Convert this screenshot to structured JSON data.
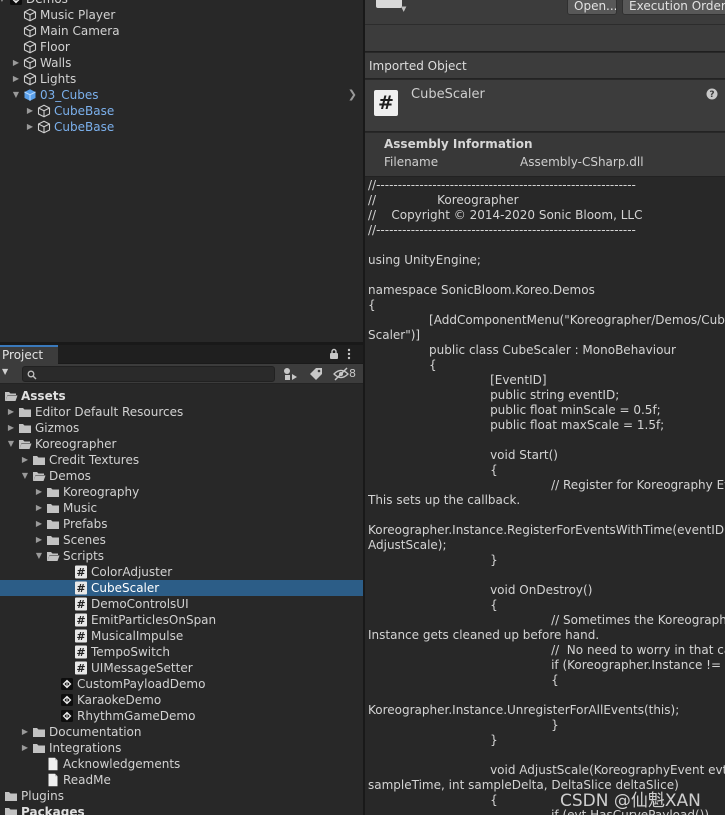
{
  "hierarchy": {
    "items": [
      {
        "label": "Demos",
        "depth": 1,
        "expand": "open",
        "icon": "unity-scene-icon",
        "blue": false
      },
      {
        "label": "Music Player",
        "depth": 2,
        "expand": "none",
        "icon": "gameobject-icon",
        "blue": false
      },
      {
        "label": "Main Camera",
        "depth": 2,
        "expand": "none",
        "icon": "gameobject-icon",
        "blue": false
      },
      {
        "label": "Floor",
        "depth": 2,
        "expand": "none",
        "icon": "gameobject-icon",
        "blue": false
      },
      {
        "label": "Walls",
        "depth": 2,
        "expand": "closed",
        "icon": "gameobject-icon",
        "blue": false
      },
      {
        "label": "Lights",
        "depth": 2,
        "expand": "closed",
        "icon": "gameobject-icon",
        "blue": false
      },
      {
        "label": "03_Cubes",
        "depth": 2,
        "expand": "open",
        "icon": "prefab-icon",
        "blue": true,
        "chevron": true
      },
      {
        "label": "CubeBase",
        "depth": 3,
        "expand": "closed",
        "icon": "prefab-outline-icon",
        "blue": true
      },
      {
        "label": "CubeBase",
        "depth": 3,
        "expand": "closed",
        "icon": "prefab-outline-icon",
        "blue": true
      }
    ]
  },
  "project": {
    "tab_label": "Project",
    "search_placeholder": "",
    "hidden_count": "8",
    "tree": [
      {
        "label": "Assets",
        "depth": 0,
        "expand": "open",
        "icon": "folder-open-icon",
        "bold": true
      },
      {
        "label": "Editor Default Resources",
        "depth": 1,
        "expand": "closed",
        "icon": "folder-icon"
      },
      {
        "label": "Gizmos",
        "depth": 1,
        "expand": "closed",
        "icon": "folder-icon"
      },
      {
        "label": "Koreographer",
        "depth": 1,
        "expand": "open",
        "icon": "folder-open-icon"
      },
      {
        "label": "Credit Textures",
        "depth": 2,
        "expand": "closed",
        "icon": "folder-icon"
      },
      {
        "label": "Demos",
        "depth": 2,
        "expand": "open",
        "icon": "folder-open-icon"
      },
      {
        "label": "Koreography",
        "depth": 3,
        "expand": "closed",
        "icon": "folder-icon"
      },
      {
        "label": "Music",
        "depth": 3,
        "expand": "closed",
        "icon": "folder-icon"
      },
      {
        "label": "Prefabs",
        "depth": 3,
        "expand": "closed",
        "icon": "folder-icon"
      },
      {
        "label": "Scenes",
        "depth": 3,
        "expand": "closed",
        "icon": "folder-icon"
      },
      {
        "label": "Scripts",
        "depth": 3,
        "expand": "open",
        "icon": "folder-open-icon"
      },
      {
        "label": "ColorAdjuster",
        "depth": 5,
        "expand": "none",
        "icon": "csharp-script-icon"
      },
      {
        "label": "CubeScaler",
        "depth": 5,
        "expand": "none",
        "icon": "csharp-script-icon",
        "selected": true
      },
      {
        "label": "DemoControlsUI",
        "depth": 5,
        "expand": "none",
        "icon": "csharp-script-icon"
      },
      {
        "label": "EmitParticlesOnSpan",
        "depth": 5,
        "expand": "none",
        "icon": "csharp-script-icon"
      },
      {
        "label": "MusicalImpulse",
        "depth": 5,
        "expand": "none",
        "icon": "csharp-script-icon"
      },
      {
        "label": "TempoSwitch",
        "depth": 5,
        "expand": "none",
        "icon": "csharp-script-icon"
      },
      {
        "label": "UIMessageSetter",
        "depth": 5,
        "expand": "none",
        "icon": "csharp-script-icon"
      },
      {
        "label": "CustomPayloadDemo",
        "depth": 4,
        "expand": "none",
        "icon": "unity-scene-icon"
      },
      {
        "label": "KaraokeDemo",
        "depth": 4,
        "expand": "none",
        "icon": "unity-scene-icon"
      },
      {
        "label": "RhythmGameDemo",
        "depth": 4,
        "expand": "none",
        "icon": "unity-scene-icon"
      },
      {
        "label": "Documentation",
        "depth": 2,
        "expand": "closed",
        "icon": "folder-icon"
      },
      {
        "label": "Integrations",
        "depth": 2,
        "expand": "closed",
        "icon": "folder-icon"
      },
      {
        "label": "Acknowledgements",
        "depth": 3,
        "expand": "none",
        "icon": "document-icon"
      },
      {
        "label": "ReadMe",
        "depth": 3,
        "expand": "none",
        "icon": "document-icon"
      },
      {
        "label": "Plugins",
        "depth": 0,
        "expand": "closed",
        "icon": "folder-icon"
      },
      {
        "label": "Packages",
        "depth": 0,
        "expand": "closed",
        "icon": "folder-icon",
        "bold": true
      }
    ]
  },
  "inspector": {
    "open_label": "Open...",
    "exec_order_label": "Execution Order...",
    "imported_object_label": "Imported Object",
    "object_name": "CubeScaler",
    "script_glyph": "#",
    "assembly_title": "Assembly Information",
    "filename_label": "Filename",
    "filename_value": "Assembly-CSharp.dll",
    "code_lines": [
      "//------------------------------------------------------------",
      "//                Koreographer",
      "//    Copyright © 2014-2020 Sonic Bloom, LLC",
      "//------------------------------------------------------------",
      "",
      "using UnityEngine;",
      "",
      "namespace SonicBloom.Koreo.Demos",
      "{",
      "                [AddComponentMenu(\"Koreographer/Demos/Cube",
      "Scaler\")]",
      "                public class CubeScaler : MonoBehaviour",
      "                {",
      "                                [EventID]",
      "                                public string eventID;",
      "                                public float minScale = 0.5f;",
      "                                public float maxScale = 1.5f;",
      "",
      "                                void Start()",
      "                                {",
      "                                                // Register for Koreography Events.",
      "This sets up the callback.",
      "",
      "Koreographer.Instance.RegisterForEventsWithTime(eventID,",
      "AdjustScale);",
      "                                }",
      "",
      "                                void OnDestroy()",
      "                                {",
      "                                                // Sometimes the Koreographer",
      "Instance gets cleaned up before hand.",
      "                                                //  No need to worry in that case.",
      "                                                if (Koreographer.Instance != null)",
      "                                                {",
      "",
      "Koreographer.Instance.UnregisterForAllEvents(this);",
      "                                                }",
      "                                }",
      "",
      "                                void AdjustScale(KoreographyEvent evt, int",
      "sampleTime, int sampleDelta, DeltaSlice deltaSlice)",
      "                                {",
      "                                                if (evt.HasCurvePayload())"
    ]
  },
  "watermark": "CSDN @仙魁XAN",
  "colors": {
    "panel": "#282828",
    "header": "#3c3c3c",
    "selection": "#2c5d87",
    "accent_tab": "#3a79bb",
    "prefab_blue": "#7bb0ec"
  }
}
